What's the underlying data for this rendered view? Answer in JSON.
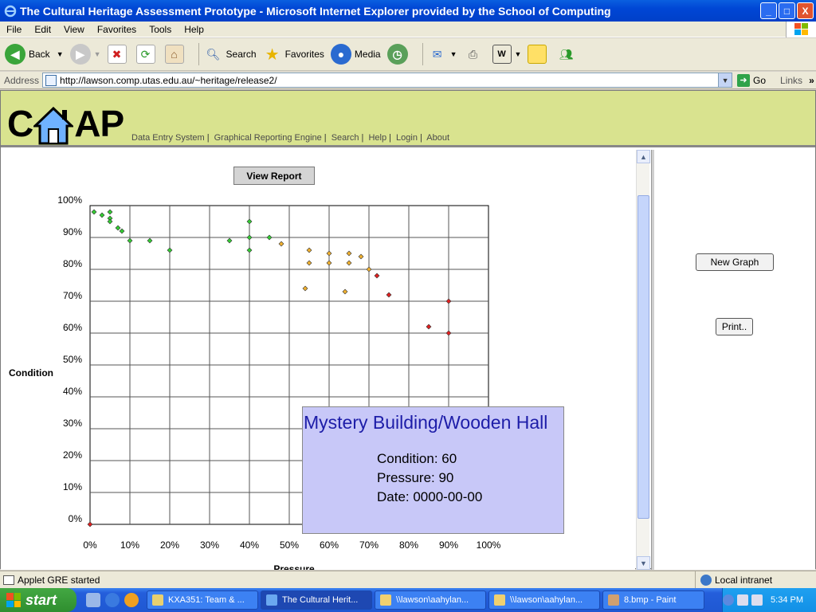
{
  "window": {
    "title": "The Cultural Heritage Assessment Prototype - Microsoft Internet Explorer provided by the School of Computing",
    "minimize": "_",
    "maximize": "□",
    "close": "X"
  },
  "menu": [
    "File",
    "Edit",
    "View",
    "Favorites",
    "Tools",
    "Help"
  ],
  "toolbar": {
    "back": "Back",
    "search": "Search",
    "favorites": "Favorites",
    "media": "Media"
  },
  "address": {
    "label": "Address",
    "url": "http://lawson.comp.utas.edu.au/~heritage/release2/",
    "go": "Go",
    "links": "Links"
  },
  "site": {
    "logo_left": "C",
    "logo_right": "AP",
    "nav": [
      "Data Entry System",
      "Graphical Reporting Engine",
      "Search",
      "Help",
      "Login",
      "About"
    ]
  },
  "applet": {
    "view_report": "View Report",
    "new_graph": "New Graph",
    "print": "Print.."
  },
  "chart_data": {
    "type": "scatter",
    "xlabel": "Pressure",
    "ylabel": "Condition",
    "xlim": [
      0,
      100
    ],
    "ylim": [
      0,
      100
    ],
    "x_ticks": [
      "0%",
      "10%",
      "20%",
      "30%",
      "40%",
      "50%",
      "60%",
      "70%",
      "80%",
      "90%",
      "100%"
    ],
    "y_ticks": [
      "0%",
      "10%",
      "20%",
      "30%",
      "40%",
      "50%",
      "60%",
      "70%",
      "80%",
      "90%",
      "100%"
    ],
    "grid": true,
    "colors": {
      "green": "#33cc33",
      "orange": "#f0b030",
      "red": "#e02020"
    },
    "points": [
      {
        "x": 1,
        "y": 98,
        "c": "green"
      },
      {
        "x": 3,
        "y": 97,
        "c": "green"
      },
      {
        "x": 5,
        "y": 98,
        "c": "green"
      },
      {
        "x": 5,
        "y": 96,
        "c": "green"
      },
      {
        "x": 5,
        "y": 95,
        "c": "green"
      },
      {
        "x": 7,
        "y": 93,
        "c": "green"
      },
      {
        "x": 8,
        "y": 92,
        "c": "green"
      },
      {
        "x": 10,
        "y": 89,
        "c": "green"
      },
      {
        "x": 15,
        "y": 89,
        "c": "green"
      },
      {
        "x": 20,
        "y": 86,
        "c": "green"
      },
      {
        "x": 35,
        "y": 89,
        "c": "green"
      },
      {
        "x": 40,
        "y": 95,
        "c": "green"
      },
      {
        "x": 40,
        "y": 90,
        "c": "green"
      },
      {
        "x": 40,
        "y": 86,
        "c": "green"
      },
      {
        "x": 45,
        "y": 90,
        "c": "green"
      },
      {
        "x": 48,
        "y": 88,
        "c": "orange"
      },
      {
        "x": 55,
        "y": 86,
        "c": "orange"
      },
      {
        "x": 55,
        "y": 82,
        "c": "orange"
      },
      {
        "x": 54,
        "y": 74,
        "c": "orange"
      },
      {
        "x": 60,
        "y": 85,
        "c": "orange"
      },
      {
        "x": 60,
        "y": 82,
        "c": "orange"
      },
      {
        "x": 65,
        "y": 85,
        "c": "orange"
      },
      {
        "x": 65,
        "y": 82,
        "c": "orange"
      },
      {
        "x": 64,
        "y": 73,
        "c": "orange"
      },
      {
        "x": 68,
        "y": 84,
        "c": "orange"
      },
      {
        "x": 70,
        "y": 80,
        "c": "orange"
      },
      {
        "x": 72,
        "y": 78,
        "c": "red"
      },
      {
        "x": 75,
        "y": 72,
        "c": "red"
      },
      {
        "x": 85,
        "y": 62,
        "c": "red"
      },
      {
        "x": 90,
        "y": 70,
        "c": "red"
      },
      {
        "x": 90,
        "y": 60,
        "c": "red"
      },
      {
        "x": 0,
        "y": 0,
        "c": "red"
      }
    ]
  },
  "tooltip": {
    "title": "Mystery Building/Wooden Hall",
    "condition": "Condition: 60",
    "pressure": "Pressure: 90",
    "date": "Date: 0000-00-00"
  },
  "status": {
    "text": "Applet GRE started",
    "zone": "Local intranet"
  },
  "taskbar": {
    "start": "start",
    "tasks": [
      "KXA351: Team & ...",
      "The Cultural Herit...",
      "\\\\lawson\\aahylan...",
      "\\\\lawson\\aahylan...",
      "8.bmp - Paint"
    ],
    "clock": "5:34 PM"
  }
}
